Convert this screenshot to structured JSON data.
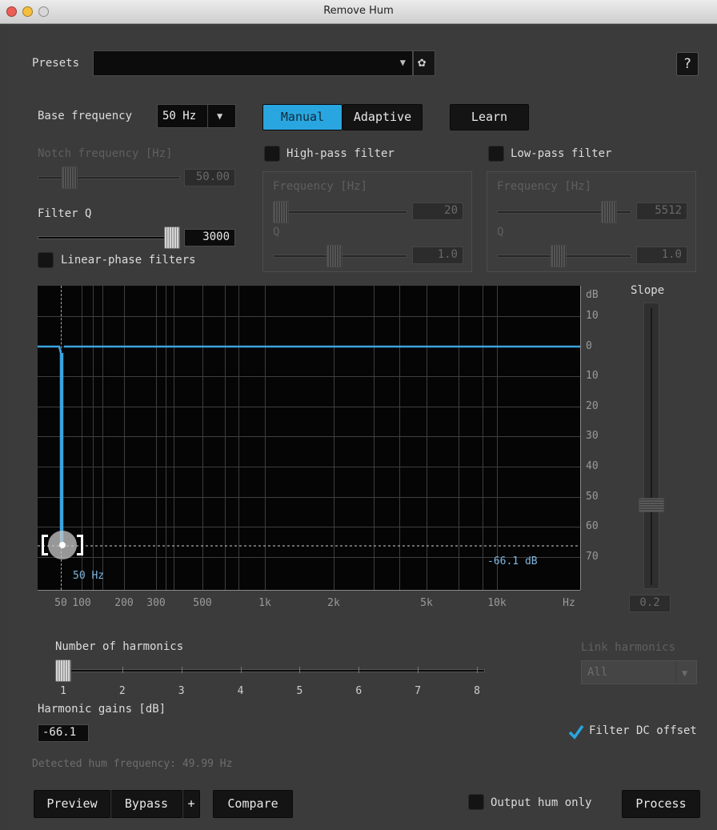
{
  "window": {
    "title": "Remove Hum"
  },
  "presets": {
    "label": "Presets",
    "value": ""
  },
  "help": {
    "label": "?"
  },
  "base_frequency": {
    "label": "Base frequency",
    "value": "50 Hz"
  },
  "mode_tabs": {
    "manual": "Manual",
    "adaptive": "Adaptive",
    "selected": "Manual"
  },
  "learn": {
    "label": "Learn"
  },
  "notch": {
    "label": "Notch frequency [Hz]",
    "value": "50.00",
    "slider_level": 0.12
  },
  "filter_q": {
    "label": "Filter Q",
    "value": "3000",
    "slider_level": 1.0
  },
  "linear_phase": {
    "label": "Linear-phase filters",
    "checked": false
  },
  "high_pass": {
    "label": "High-pass filter",
    "checked": false,
    "frequency_label": "Frequency [Hz]",
    "frequency_value": "20",
    "frequency_level": 0.0,
    "q_label": "Q",
    "q_value": "1.0",
    "q_level": 0.45
  },
  "low_pass": {
    "label": "Low-pass filter",
    "checked": false,
    "frequency_label": "Frequency [Hz]",
    "frequency_value": "5512",
    "frequency_level": 0.88,
    "q_label": "Q",
    "q_value": "1.0",
    "q_level": 0.45
  },
  "graph": {
    "y_unit": "dB",
    "y_ticks": [
      "10",
      "0",
      "10",
      "20",
      "30",
      "40",
      "50",
      "60",
      "70"
    ],
    "x_ticks": [
      "50",
      "100",
      "200",
      "300",
      "500",
      "1k",
      "2k",
      "5k",
      "10k",
      "Hz"
    ],
    "cursor_freq_label": "50 Hz",
    "cursor_gain_label": "-66.1 dB",
    "curve_color": "#3ba3dd"
  },
  "slope": {
    "label": "Slope",
    "value": "0.2",
    "slider_level": 0.2
  },
  "harmonics": {
    "label": "Number of harmonics",
    "ticks": [
      "1",
      "2",
      "3",
      "4",
      "5",
      "6",
      "7",
      "8"
    ],
    "value_index": 1
  },
  "link_harmonics": {
    "label": "Link harmonics",
    "value": "All"
  },
  "harmonic_gains": {
    "label": "Harmonic gains [dB]",
    "value": "-66.1"
  },
  "filter_dc": {
    "label": "Filter DC offset",
    "checked": true
  },
  "detected": {
    "label": "Detected hum frequency: 49.99 Hz"
  },
  "bottom": {
    "preview": "Preview",
    "bypass": "Bypass",
    "plus": "+",
    "compare": "Compare",
    "output_hum_only": "Output hum only",
    "process": "Process"
  },
  "colors": {
    "accent": "#29a6e0",
    "check": "#29a6e0",
    "background": "#3b3b3b"
  }
}
